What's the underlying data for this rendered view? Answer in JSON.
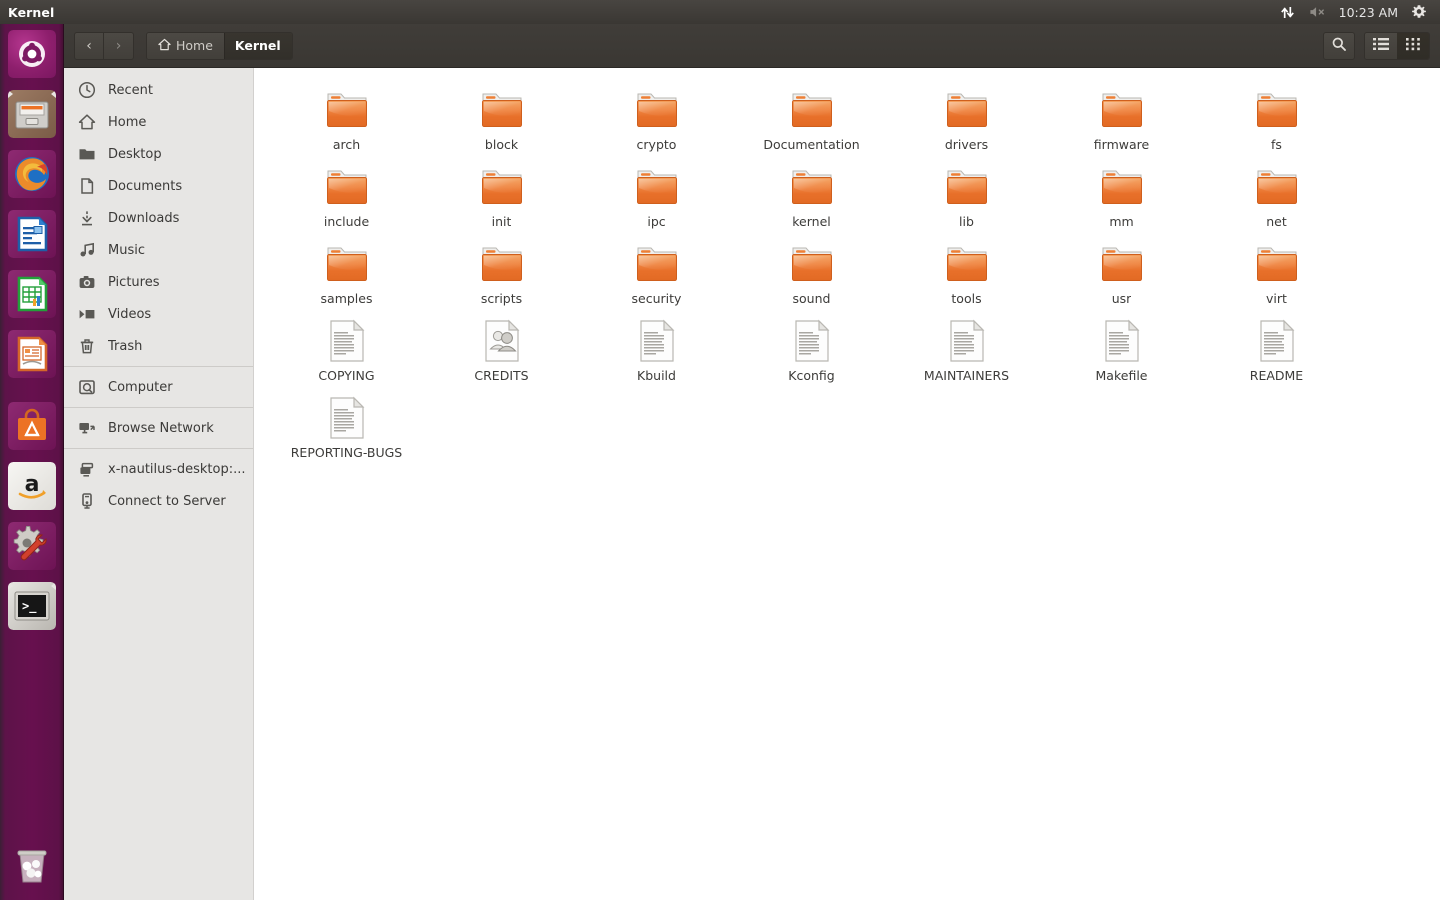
{
  "panel": {
    "title": "Kernel",
    "clock": "10:23 AM",
    "tray_icons": [
      "network-updown-icon",
      "volume-muted-icon",
      "system-gear-icon"
    ]
  },
  "launcher": {
    "items": [
      {
        "name": "ubuntu-dash-icon",
        "label": "Ubuntu Dash",
        "running": false
      },
      {
        "name": "files-nautilus-icon",
        "label": "Files",
        "running": true
      },
      {
        "name": "firefox-icon",
        "label": "Firefox Web Browser",
        "running": false
      },
      {
        "name": "libreoffice-writer-icon",
        "label": "LibreOffice Writer",
        "running": false
      },
      {
        "name": "libreoffice-calc-icon",
        "label": "LibreOffice Calc",
        "running": false
      },
      {
        "name": "libreoffice-impress-icon",
        "label": "LibreOffice Impress",
        "running": false
      },
      {
        "name": "ubuntu-software-icon",
        "label": "Ubuntu Software",
        "running": false
      },
      {
        "name": "amazon-icon",
        "label": "Amazon",
        "running": false
      },
      {
        "name": "system-settings-icon",
        "label": "System Settings",
        "running": false
      },
      {
        "name": "terminal-icon",
        "label": "Terminal",
        "running": true
      },
      {
        "name": "trash-icon",
        "label": "Trash",
        "running": false
      }
    ]
  },
  "toolbar": {
    "back_label": "‹",
    "forward_label": "›",
    "breadcrumbs": [
      {
        "label": "Home",
        "icon": "home-icon",
        "active": false
      },
      {
        "label": "Kernel",
        "icon": "",
        "active": true
      }
    ],
    "search_icon": "search-icon",
    "view_list_icon": "list-view-icon",
    "view_grid_icon": "grid-view-icon",
    "active_view": "grid"
  },
  "sidebar": {
    "items": [
      {
        "label": "Recent",
        "icon": "clock-icon",
        "sep_before": false
      },
      {
        "label": "Home",
        "icon": "home-icon",
        "sep_before": false
      },
      {
        "label": "Desktop",
        "icon": "folder-icon",
        "sep_before": false
      },
      {
        "label": "Documents",
        "icon": "document-icon",
        "sep_before": false
      },
      {
        "label": "Downloads",
        "icon": "download-icon",
        "sep_before": false
      },
      {
        "label": "Music",
        "icon": "music-icon",
        "sep_before": false
      },
      {
        "label": "Pictures",
        "icon": "camera-icon",
        "sep_before": false
      },
      {
        "label": "Videos",
        "icon": "video-icon",
        "sep_before": false
      },
      {
        "label": "Trash",
        "icon": "trash-icon",
        "sep_before": false
      },
      {
        "label": "Computer",
        "icon": "disk-icon",
        "sep_before": true
      },
      {
        "label": "Browse Network",
        "icon": "network-icon",
        "sep_before": true
      },
      {
        "label": "x-nautilus-desktop:...",
        "icon": "desktop-icon",
        "sep_before": true
      },
      {
        "label": "Connect to Server",
        "icon": "server-icon",
        "sep_before": false
      }
    ]
  },
  "files": {
    "items": [
      {
        "label": "arch",
        "type": "folder"
      },
      {
        "label": "block",
        "type": "folder"
      },
      {
        "label": "crypto",
        "type": "folder"
      },
      {
        "label": "Documentation",
        "type": "folder"
      },
      {
        "label": "drivers",
        "type": "folder"
      },
      {
        "label": "firmware",
        "type": "folder"
      },
      {
        "label": "fs",
        "type": "folder"
      },
      {
        "label": "include",
        "type": "folder"
      },
      {
        "label": "init",
        "type": "folder"
      },
      {
        "label": "ipc",
        "type": "folder"
      },
      {
        "label": "kernel",
        "type": "folder"
      },
      {
        "label": "lib",
        "type": "folder"
      },
      {
        "label": "mm",
        "type": "folder"
      },
      {
        "label": "net",
        "type": "folder"
      },
      {
        "label": "samples",
        "type": "folder"
      },
      {
        "label": "scripts",
        "type": "folder"
      },
      {
        "label": "security",
        "type": "folder"
      },
      {
        "label": "sound",
        "type": "folder"
      },
      {
        "label": "tools",
        "type": "folder"
      },
      {
        "label": "usr",
        "type": "folder"
      },
      {
        "label": "virt",
        "type": "folder"
      },
      {
        "label": "COPYING",
        "type": "text"
      },
      {
        "label": "CREDITS",
        "type": "contacts"
      },
      {
        "label": "Kbuild",
        "type": "text"
      },
      {
        "label": "Kconfig",
        "type": "text"
      },
      {
        "label": "MAINTAINERS",
        "type": "text"
      },
      {
        "label": "Makefile",
        "type": "text"
      },
      {
        "label": "README",
        "type": "text"
      },
      {
        "label": "REPORTING-BUGS",
        "type": "text"
      }
    ]
  },
  "colors": {
    "panel_bg": "#413e3a",
    "launcher_bg": "#681250",
    "toolbar_bg": "#3a3733",
    "sidebar_bg": "#e7e6e4",
    "folder_orange": "#e8762d",
    "accent_white": "#ffffff"
  }
}
